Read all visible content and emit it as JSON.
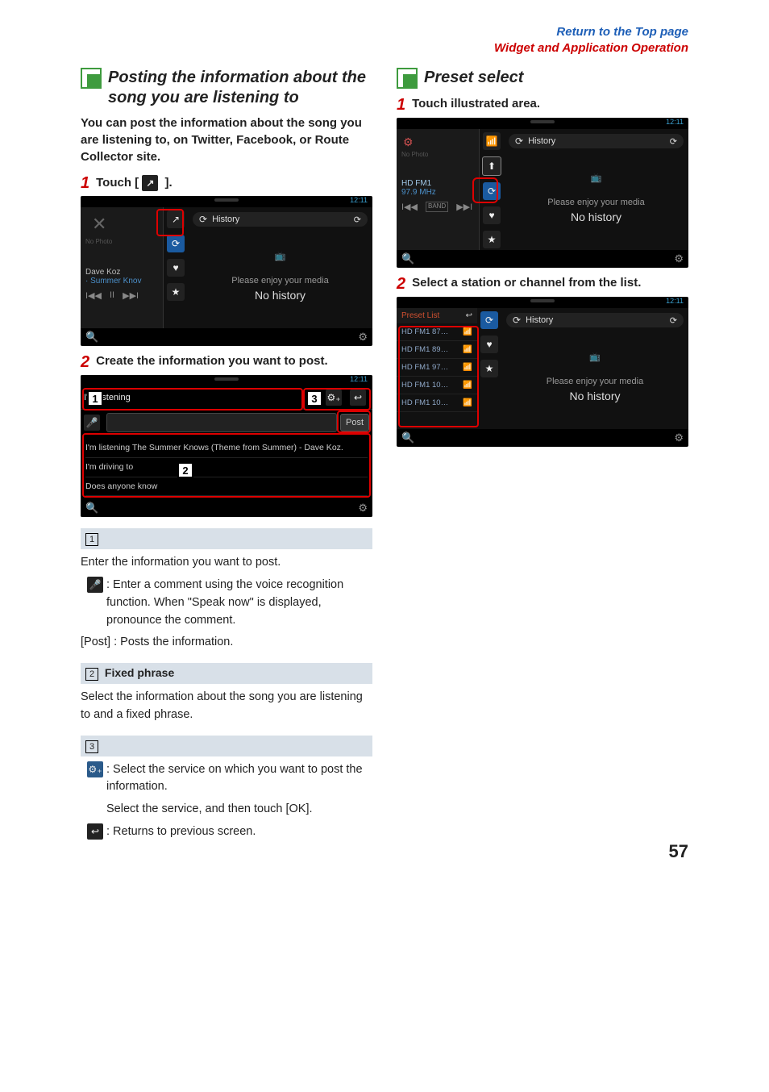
{
  "header": {
    "top_link": "Return to the Top page",
    "section_link": "Widget and Application Operation"
  },
  "left": {
    "title": "Posting the information about the song you are listening to",
    "intro": "You can post the information about the song you are listening to, on Twitter, Facebook, or Route Collector site.",
    "step1_prefix": "Touch [ ",
    "step1_suffix": " ].",
    "step2": "Create the information you want to post.",
    "shot1": {
      "time": "12:11",
      "history": "History",
      "artist": "Dave Koz",
      "track": "· Summer Knov",
      "msg1": "Please enjoy your media",
      "msg2": "No history",
      "nophoto": "No Photo"
    },
    "shot2": {
      "time": "12:11",
      "title": "I'm listening",
      "post_btn": "Post",
      "line1": "I'm listening The Summer Knows (Theme from Summer) - Dave Koz.",
      "line2": "I'm driving to",
      "line3": "Does anyone know"
    },
    "ref1_desc": "Enter the information you want to post.",
    "ref1_icon_desc": ": Enter a comment using the voice recognition function. When \"Speak now\" is displayed, pronounce the comment.",
    "ref1_post": "[Post] : Posts the information.",
    "ref2_title": "Fixed phrase",
    "ref2_desc": "Select the information about the song you are listening to and a fixed phrase.",
    "ref3_icon_desc": ": Select the service on which you want to post the information.",
    "ref3_icon_desc2": "Select the service, and then touch [OK].",
    "ref3_back": ": Returns to previous screen."
  },
  "right": {
    "title": "Preset select",
    "step1": "Touch illustrated area.",
    "step2": "Select a station or channel from the list.",
    "shot1": {
      "time": "12:11",
      "history": "History",
      "band": "HD FM1",
      "freq": "97.9 MHz",
      "bandlbl": "BAND",
      "msg1": "Please enjoy your media",
      "msg2": "No history",
      "nophoto": "No Photo"
    },
    "shot2": {
      "time": "12:11",
      "history": "History",
      "preset_label": "Preset List",
      "items": [
        "HD FM1 87…",
        "HD FM1 89…",
        "HD FM1 97…",
        "HD FM1 10…",
        "HD FM1 10…"
      ],
      "msg1": "Please enjoy your media",
      "msg2": "No history"
    }
  },
  "page_number": "57"
}
